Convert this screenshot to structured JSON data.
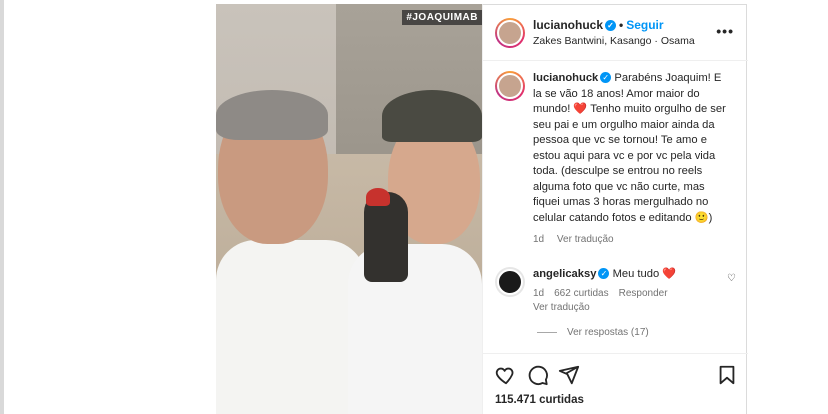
{
  "post": {
    "media_tag": "#JOAQUIMAB",
    "header": {
      "username": "lucianohuck",
      "follow_label": "Seguir",
      "audio": "Zakes Bantwini, Kasango · Osama",
      "more_icon": "more-horizontal-icon"
    },
    "caption": {
      "username": "lucianohuck",
      "text": "Parabéns Joaquim! E la se vão 18 anos! Amor maior do mundo! ❤️ Tenho muito orgulho de ser seu pai e um orgulho maior ainda da pessoa que vc se tornou! Te amo e estou aqui para vc e por vc pela vida toda. (desculpe se entrou no reels alguma foto que vc não curte, mas fiquei umas 3 horas mergulhado no celular catando fotos e editando 🙂)",
      "age": "1d",
      "translate_label": "Ver tradução"
    },
    "comment": {
      "username": "angelicaksy",
      "text": "Meu tudo ❤️",
      "age": "1d",
      "likes": "662 curtidas",
      "reply_label": "Responder",
      "translate_label": "Ver tradução"
    },
    "view_replies": "Ver respostas (17)",
    "likes_count": "115.471 curtidas"
  },
  "colors": {
    "accent_blue": "#0095f6",
    "heart_red": "#ed4956",
    "secondary_text": "#737373"
  }
}
